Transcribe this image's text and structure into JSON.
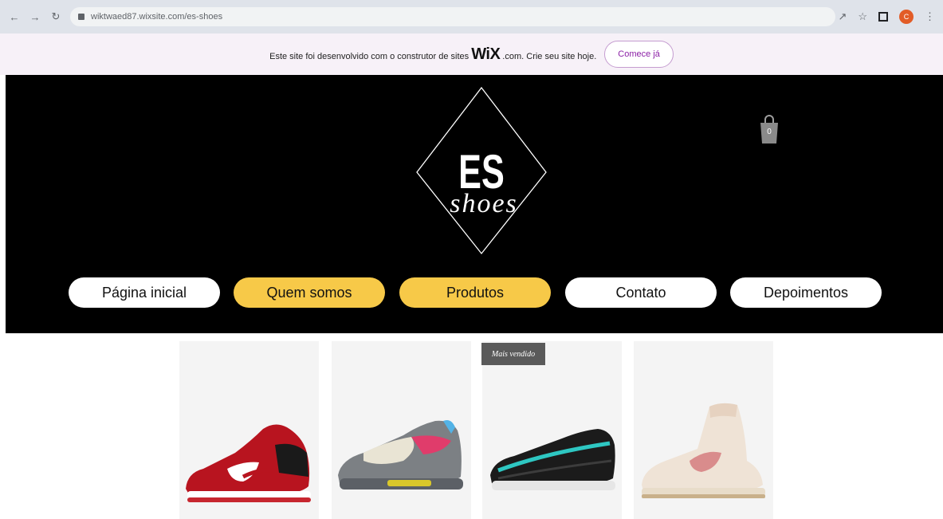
{
  "browser": {
    "url": "wiktwaed87.wixsite.com/es-shoes",
    "profile_initial": "C"
  },
  "wix_banner": {
    "text_before": "Este site foi desenvolvido com o construtor de sites",
    "wix_logo": "WiX",
    "text_after": ".com. Crie seu site hoje.",
    "button": "Comece já"
  },
  "logo": {
    "main": "ES",
    "script": "shoes"
  },
  "cart": {
    "count": "0"
  },
  "menu": [
    {
      "label": "Página inicial",
      "style": "white"
    },
    {
      "label": "Quem somos",
      "style": "yellow"
    },
    {
      "label": "Produtos",
      "style": "yellow"
    },
    {
      "label": "Contato",
      "style": "white"
    },
    {
      "label": "Depoimentos",
      "style": "white"
    }
  ],
  "products": {
    "badge": "Mais vendido",
    "items": [
      {
        "name": "red-black-low-sneaker",
        "main_color": "#b8141f",
        "accent": "#1a1a1a"
      },
      {
        "name": "multicolor-air-max-95",
        "main_color": "#7c8084",
        "accent": "#e03c6b"
      },
      {
        "name": "black-teal-air-max-97",
        "main_color": "#1b1b1b",
        "accent": "#2ec7c2"
      },
      {
        "name": "cream-pink-high-top",
        "main_color": "#efe3d6",
        "accent": "#d98c8c"
      }
    ]
  },
  "colors": {
    "hero_bg": "#000000",
    "menu_yellow": "#f7c948",
    "banner_bg": "#f7f1f8",
    "wix_button_text": "#8b1fa6"
  }
}
